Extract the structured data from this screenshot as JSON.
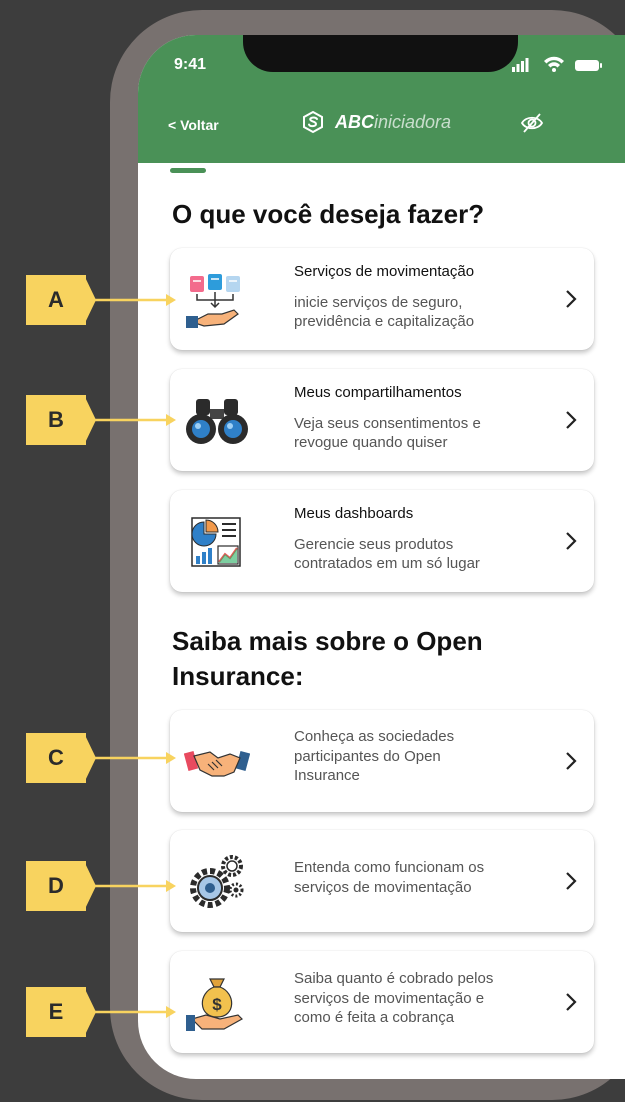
{
  "status": {
    "time": "9:41"
  },
  "header": {
    "back": "< Voltar",
    "brand_bold": "ABC",
    "brand_rest": "iniciadora"
  },
  "section1": {
    "title": "O que você deseja fazer?"
  },
  "cards": [
    {
      "title": "Serviços de movimentação",
      "desc1": "inicie serviços de seguro,",
      "desc2": "previdência e capitalização",
      "icon": "documents-hand-icon"
    },
    {
      "title": "Meus compartilhamentos",
      "desc1": "Veja seus consentimentos e",
      "desc2": "revogue quando quiser",
      "icon": "binoculars-icon"
    },
    {
      "title": "Meus dashboards",
      "desc1": "Gerencie seus produtos",
      "desc2": "contratados em um só lugar",
      "icon": "dashboard-icon"
    }
  ],
  "section2": {
    "title_line1": "Saiba mais sobre o Open",
    "title_line2": "Insurance:"
  },
  "info_cards": [
    {
      "line1": "Conheça as sociedades",
      "line2": "participantes do Open",
      "line3": "Insurance",
      "icon": "handshake-icon"
    },
    {
      "line1": "Entenda como funcionam os",
      "line2": "serviços de movimentação",
      "line3": "",
      "icon": "gears-icon"
    },
    {
      "line1": "Saiba quanto é cobrado pelos",
      "line2": "serviços de movimentação e",
      "line3": "como é feita a cobrança",
      "icon": "money-bag-icon"
    }
  ],
  "labels": [
    "A",
    "B",
    "C",
    "D",
    "E"
  ],
  "colors": {
    "header_green": "#4a9157",
    "label_yellow": "#f8d35f",
    "background": "#3d3d3d"
  }
}
